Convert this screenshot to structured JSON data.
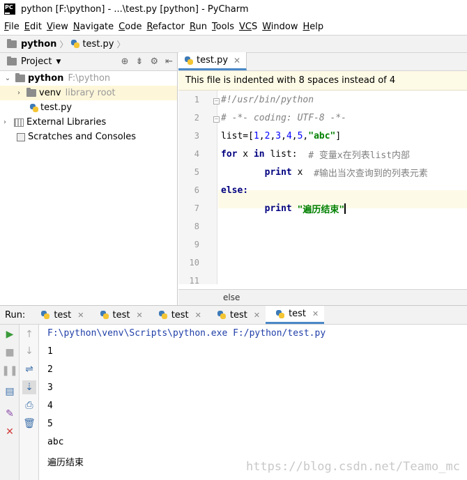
{
  "window": {
    "app_icon_text": "PC",
    "title": "python [F:\\python] - ...\\test.py [python] - PyCharm"
  },
  "menu": [
    {
      "u": "F",
      "rest": "ile"
    },
    {
      "u": "E",
      "rest": "dit"
    },
    {
      "u": "V",
      "rest": "iew"
    },
    {
      "u": "N",
      "rest": "avigate"
    },
    {
      "u": "C",
      "rest": "ode"
    },
    {
      "u": "R",
      "rest": "efactor"
    },
    {
      "u": "R",
      "rest": "un"
    },
    {
      "u": "T",
      "rest": "ools"
    },
    {
      "u": "VC",
      "rest": "S"
    },
    {
      "u": "W",
      "rest": "indow"
    },
    {
      "u": "H",
      "rest": "elp"
    }
  ],
  "breadcrumb": {
    "project": "python",
    "file": "test.py"
  },
  "project_panel": {
    "title": "Project",
    "tree": {
      "root_name": "python",
      "root_path": "F:\\python",
      "venv_name": "venv",
      "venv_hint": "library root",
      "file": "test.py",
      "external": "External Libraries",
      "scratches": "Scratches and Consoles"
    }
  },
  "editor": {
    "tab": "test.py",
    "banner": "This file is indented with 8 spaces instead of 4",
    "line_numbers": [
      "1",
      "2",
      "3",
      "4",
      "5",
      "6",
      "7",
      "8",
      "9",
      "10",
      "11"
    ],
    "code": {
      "l1": "#!/usr/bin/python",
      "l2": "# -*- coding: UTF-8 -*-",
      "l3_a": "list=[",
      "l3_n": [
        "1",
        "2",
        "3",
        "4",
        "5"
      ],
      "l3_s": "\"abc\"",
      "l3_end": "]",
      "l4_for": "for",
      "l4_mid": " x ",
      "l4_in": "in",
      "l4_list": " list:  ",
      "l4_cmt": "# 变量x在列表list内部",
      "l5_print": "print",
      "l5_x": " x  ",
      "l5_cmt": "#输出当次查询到的列表元素",
      "l6": "else:",
      "l7_print": "print",
      "l7_str": "\"遍历结束\""
    },
    "status": "else"
  },
  "run": {
    "label": "Run:",
    "tabs": [
      "test",
      "test",
      "test",
      "test",
      "test"
    ],
    "output": [
      "F:\\python\\venv\\Scripts\\python.exe F:/python/test.py",
      "1",
      "2",
      "3",
      "4",
      "5",
      "abc",
      "遍历结束"
    ]
  },
  "watermark": "https://blog.csdn.net/Teamo_mc",
  "colors": {
    "keyword": "#000080",
    "number": "#0000ff",
    "string": "#008000",
    "comment": "#808080",
    "accent": "#4a88c7",
    "banner": "#fdfae6"
  }
}
